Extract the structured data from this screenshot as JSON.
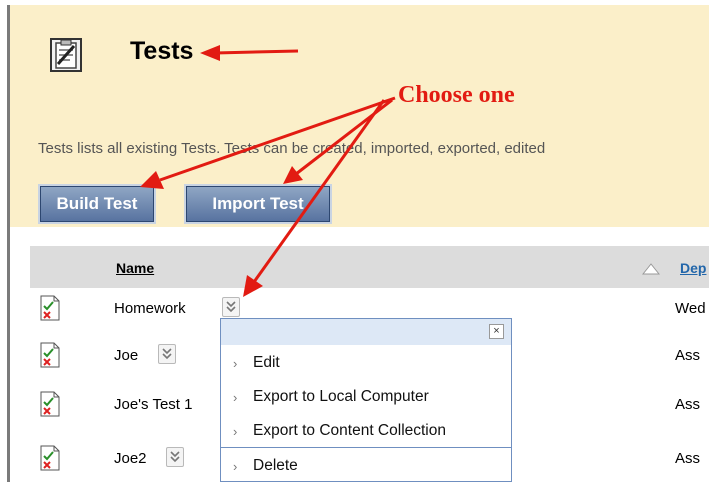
{
  "header": {
    "title": "Tests",
    "description": "Tests lists all existing Tests. Tests can be created, imported, exported, edited",
    "build_button": "Build Test",
    "import_button": "Import Test"
  },
  "annotation": {
    "text": "Choose one",
    "color": "#e21b12"
  },
  "table": {
    "columns": [
      "Name",
      "Dep"
    ],
    "rows": [
      {
        "name": "Homework",
        "dep": "Wed"
      },
      {
        "name": "Joe",
        "dep": "Ass"
      },
      {
        "name": "Joe's Test 1",
        "dep": "Ass"
      },
      {
        "name": "Joe2",
        "dep": "Ass"
      }
    ]
  },
  "context_menu": {
    "close_label": "×",
    "arrow": "›",
    "items": [
      "Edit",
      "Export to Local Computer",
      "Export to Content Collection",
      "Delete"
    ]
  },
  "colors": {
    "header_bg": "#fbefc9",
    "button_blue": "#5873a0",
    "menu_border": "#6f8fc0",
    "annotation_red": "#e21b12"
  }
}
